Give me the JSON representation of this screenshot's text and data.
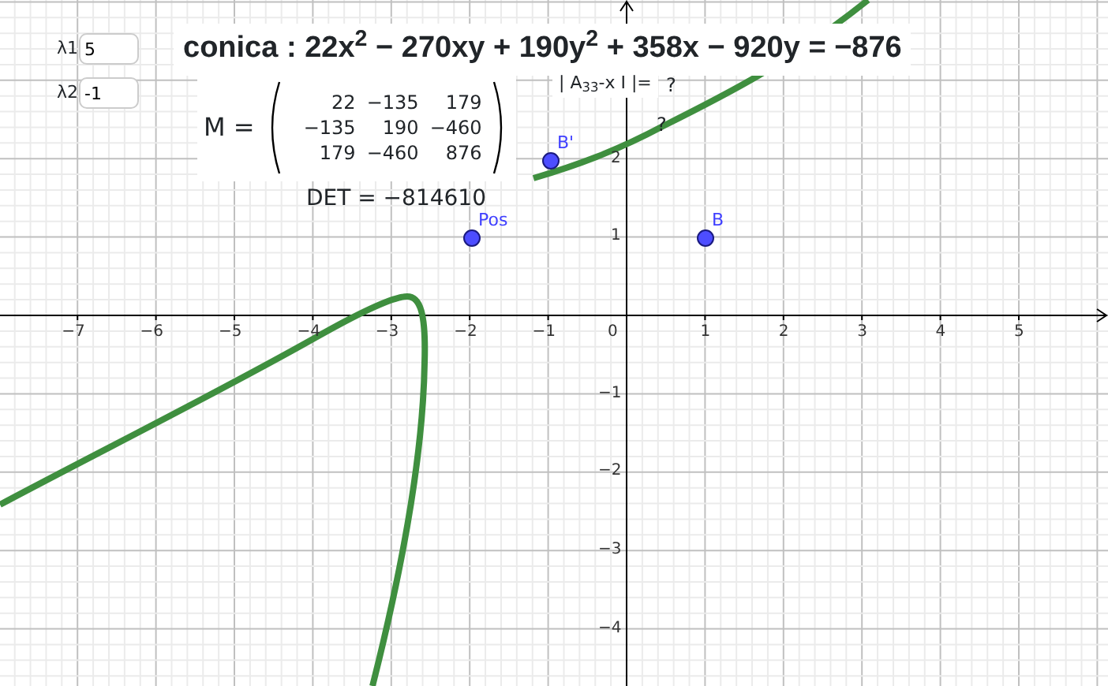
{
  "inputs": [
    {
      "label": "λ1",
      "value": "5"
    },
    {
      "label": "λ2",
      "value": "-1"
    }
  ],
  "equation": "conica : 22x$^{2}$ − 270xy + 190y$^{2}$ + 358x − 920y = −876",
  "matrix": {
    "name": "M =",
    "rows": [
      [
        "22",
        "−135",
        "179"
      ],
      [
        "−135",
        "190",
        "−460"
      ],
      [
        "179",
        "−460",
        "876"
      ]
    ]
  },
  "det": "DET = −814610",
  "eigen_text": "| A$_{33}$-x I |=",
  "eigen_value": "?",
  "curve_label": "?",
  "points": [
    {
      "label": "B'"
    },
    {
      "label": "Pos"
    },
    {
      "label": "B"
    }
  ],
  "x_ticks": [
    "−7",
    "−6",
    "−5",
    "−4",
    "−3",
    "−2",
    "−1",
    "0",
    "1",
    "2",
    "3",
    "4",
    "5"
  ],
  "y_ticks": [
    "2",
    "1",
    "−1",
    "−2",
    "−3",
    "−4"
  ]
}
